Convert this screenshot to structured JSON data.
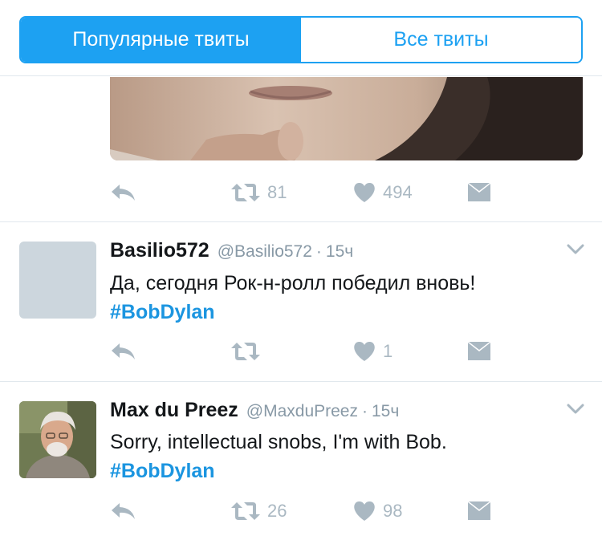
{
  "tabs": {
    "popular": "Популярные твиты",
    "all": "Все твиты"
  },
  "tweets": [
    {
      "retweets": "81",
      "likes": "494"
    },
    {
      "name": "Basilio572",
      "handle": "@Basilio572",
      "separator": "·",
      "time": "15ч",
      "text": "Да, сегодня Рок-н-ролл победил вновь!",
      "hashtag": "#BobDylan",
      "retweets": "",
      "likes": "1"
    },
    {
      "name": "Max du Preez",
      "handle": "@MaxduPreez",
      "separator": "·",
      "time": "15ч",
      "text": "Sorry, intellectual snobs, I'm with Bob.",
      "hashtag": "#BobDylan",
      "retweets": "26",
      "likes": "98"
    }
  ],
  "colors": {
    "accent": "#1da1f2",
    "hashtag": "#1b95e0",
    "icon": "#aab8c2",
    "meta": "#8899a6",
    "divider": "#e1e8ed"
  },
  "icons": [
    "reply-icon",
    "retweet-icon",
    "heart-icon",
    "direct-message-icon",
    "chevron-down-icon"
  ]
}
